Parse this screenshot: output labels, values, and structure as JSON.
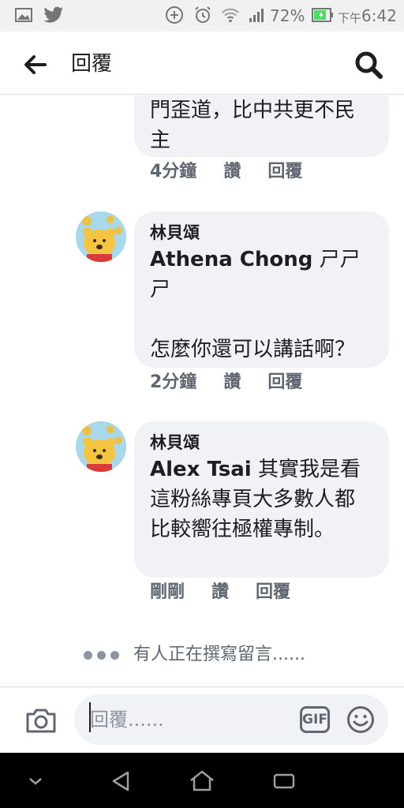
{
  "status_bar": {
    "battery": "72%",
    "time_prefix": "下午",
    "time": "6:42",
    "icons": [
      "gallery-icon",
      "twitter-icon",
      "data-saver-icon",
      "alarm-icon",
      "wifi-icon",
      "signal-icon",
      "battery-icon"
    ]
  },
  "header": {
    "title": "回覆",
    "back_icon": "arrow-left-icon",
    "search_icon": "search-icon"
  },
  "comments": [
    {
      "author": "",
      "mention": "",
      "text": "門歪道，比中共更不民主",
      "time": "4分鐘"
    },
    {
      "author": "林貝頌",
      "mention": "Athena Chong",
      "text": "ㄕㄕㄕ\n\n怎麼你還可以講話啊？",
      "time": "2分鐘"
    },
    {
      "author": "林貝頌",
      "mention": "Alex Tsai",
      "text": "其實我是看這粉絲專頁大多數人都比較嚮往極權專制。",
      "time": "剛剛"
    }
  ],
  "actions": {
    "like": "讚",
    "reply": "回覆"
  },
  "typing_indicator": "有人正在撰寫留言......",
  "composer": {
    "placeholder": "回覆......",
    "gif_label": "GIF",
    "camera_icon": "camera-icon",
    "emoji_icon": "smiley-icon"
  },
  "nav_bar": {
    "icons": [
      "collapse-icon",
      "back-triangle-icon",
      "home-icon",
      "recents-icon"
    ]
  },
  "colors": {
    "bubble": "#f0f2f5",
    "text": "#1c1e21",
    "secondary": "#606770",
    "battery_green": "#4cd964"
  }
}
